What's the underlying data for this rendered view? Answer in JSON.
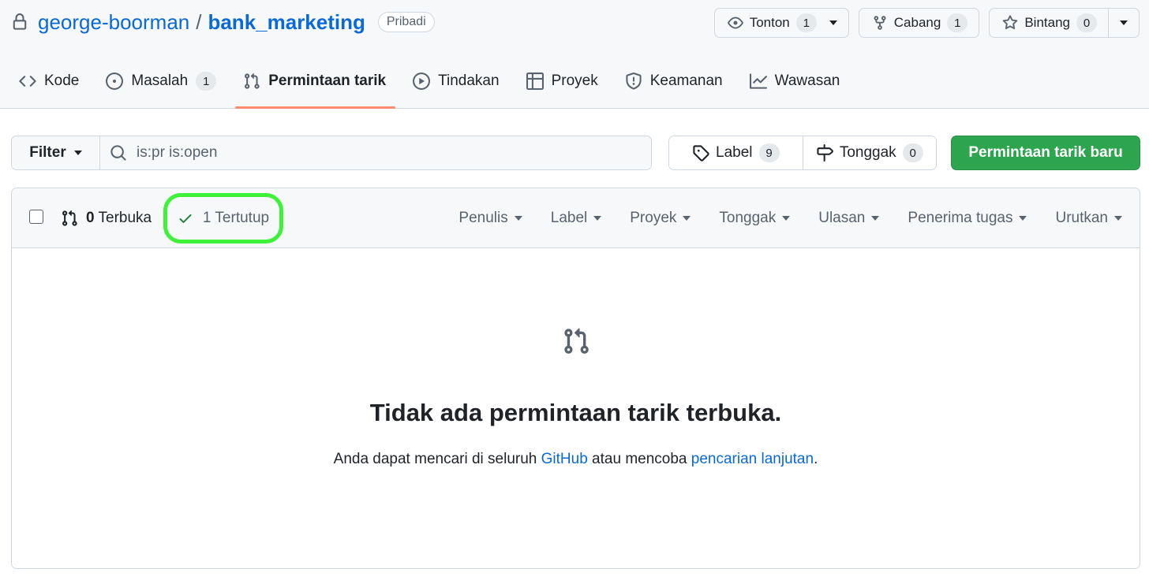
{
  "repo": {
    "owner": "george-boorman",
    "separator": "/",
    "name": "bank_marketing",
    "visibility": "Pribadi"
  },
  "actions": {
    "watch": {
      "label": "Tonton",
      "count": "1"
    },
    "fork": {
      "label": "Cabang",
      "count": "1"
    },
    "star": {
      "label": "Bintang",
      "count": "0"
    }
  },
  "tabs": [
    {
      "label": "Kode",
      "icon": "code-icon"
    },
    {
      "label": "Masalah",
      "icon": "issue-icon",
      "count": "1"
    },
    {
      "label": "Permintaan tarik",
      "icon": "pull-request-icon",
      "active": true
    },
    {
      "label": "Tindakan",
      "icon": "play-icon"
    },
    {
      "label": "Proyek",
      "icon": "table-icon"
    },
    {
      "label": "Keamanan",
      "icon": "shield-icon"
    },
    {
      "label": "Wawasan",
      "icon": "graph-icon"
    }
  ],
  "toolbar": {
    "filter_label": "Filter",
    "search_value": "is:pr is:open",
    "label_label": "Label",
    "label_count": "9",
    "milestone_label": "Tonggak",
    "milestone_count": "0",
    "new_pr_label": "Permintaan tarik baru"
  },
  "list": {
    "open_count": "0",
    "open_label": "Terbuka",
    "closed_label": "1 Tertutup",
    "highlight_color": "#3ef23a",
    "filters": [
      "Penulis",
      "Label",
      "Proyek",
      "Tonggak",
      "Ulasan",
      "Penerima tugas",
      "Urutkan"
    ]
  },
  "blankslate": {
    "title": "Tidak ada permintaan tarik terbuka.",
    "text_before": "Anda dapat mencari di seluruh ",
    "link_github": "GitHub",
    "text_middle": " atau mencoba ",
    "link_advanced": "pencarian lanjutan",
    "text_after": "."
  },
  "colors": {
    "accent": "#0969da",
    "primary_button": "#2da44e",
    "active_tab_underline": "#fd8c73"
  }
}
